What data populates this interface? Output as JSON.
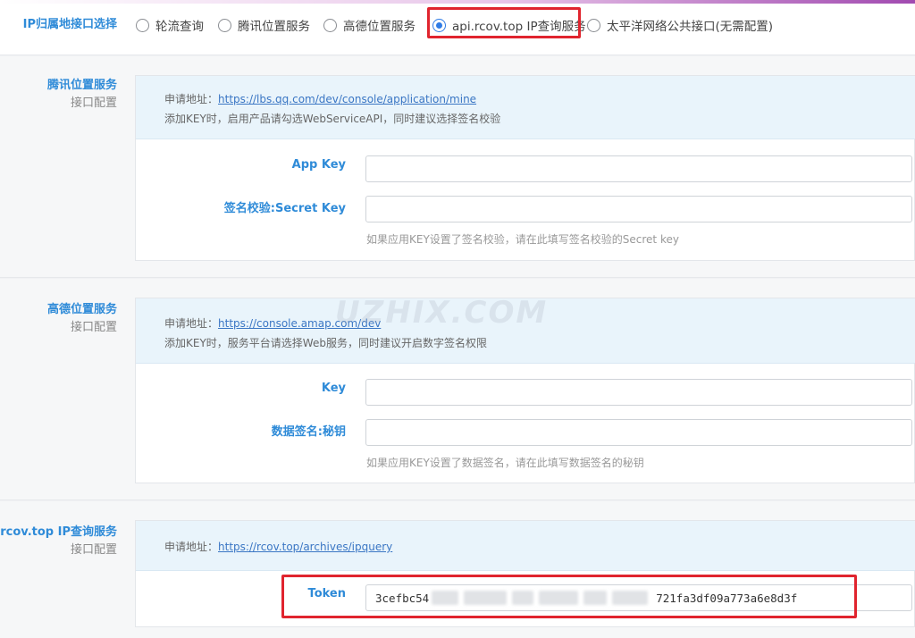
{
  "ip_selector": {
    "label": "IP归属地接口选择",
    "options": [
      {
        "label": "轮流查询",
        "checked": false
      },
      {
        "label": "腾讯位置服务",
        "checked": false
      },
      {
        "label": "高德位置服务",
        "checked": false
      },
      {
        "label": "api.rcov.top IP查询服务",
        "checked": true
      },
      {
        "label": "太平洋网络公共接口(无需配置)",
        "checked": false
      }
    ]
  },
  "tencent": {
    "title": "腾讯位置服务",
    "subtitle": "接口配置",
    "apply_prefix": "申请地址：",
    "apply_url": "https://lbs.qq.com/dev/console/application/mine",
    "note": "添加KEY时，启用产品请勾选WebServiceAPI，同时建议选择签名校验",
    "app_key_label": "App Key",
    "app_key_value": "",
    "secret_label": "签名校验:Secret Key",
    "secret_value": "",
    "secret_hint": "如果应用KEY设置了签名校验，请在此填写签名校验的Secret key"
  },
  "amap": {
    "title": "高德位置服务",
    "subtitle": "接口配置",
    "apply_prefix": "申请地址：",
    "apply_url": "https://console.amap.com/dev",
    "note": "添加KEY时，服务平台请选择Web服务，同时建议开启数字签名权限",
    "key_label": "Key",
    "key_value": "",
    "secret_label": "数据签名:秘钥",
    "secret_value": "",
    "secret_hint": "如果应用KEY设置了数据签名，请在此填写数据签名的秘钥"
  },
  "rcov": {
    "title": "pi.rcov.top IP查询服务",
    "subtitle": "接口配置",
    "apply_prefix": "申请地址：",
    "apply_url": "https://rcov.top/archives/ipquery",
    "token_label": "Token",
    "token_start": "3cefbc54",
    "token_end": "721fa3df09a773a6e8d3f"
  },
  "watermark": "UZHIX.COM"
}
